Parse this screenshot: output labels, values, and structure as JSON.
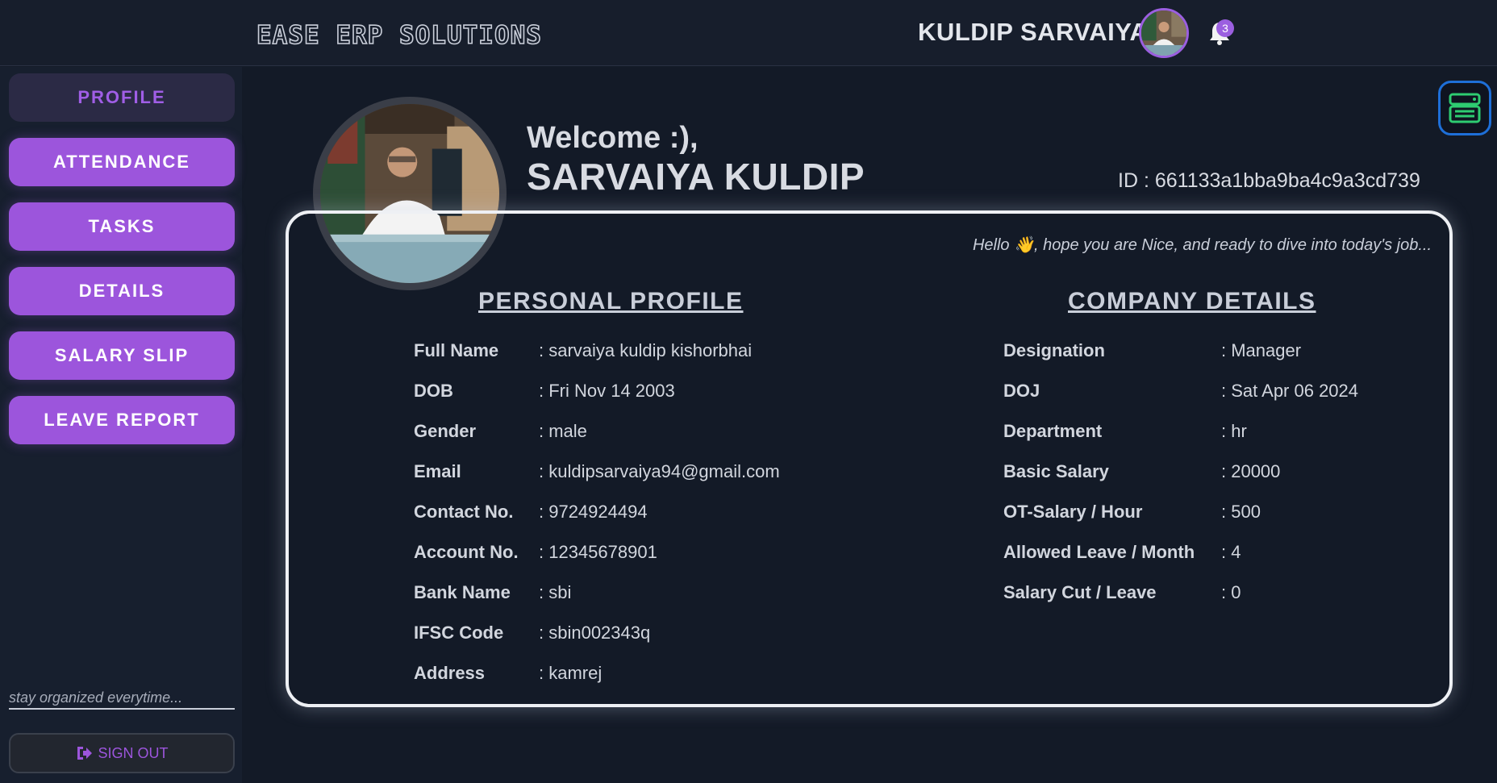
{
  "header": {
    "brand": "EASE ERP SOLUTIONS",
    "user_name": "KULDIP SARVAIYA",
    "notification_count": "3"
  },
  "sidebar": {
    "items": [
      {
        "label": "PROFILE",
        "active": true
      },
      {
        "label": "ATTENDANCE",
        "active": false
      },
      {
        "label": "TASKS",
        "active": false
      },
      {
        "label": "DETAILS",
        "active": false
      },
      {
        "label": "SALARY SLIP",
        "active": false
      },
      {
        "label": "LEAVE REPORT",
        "active": false
      }
    ],
    "tagline": "stay organized everytime...",
    "signout_label": "SIGN OUT"
  },
  "main": {
    "welcome": "Welcome :),",
    "name": "SARVAIYA KULDIP",
    "id_text": "ID : 661133a1bba9ba4c9a3cd739",
    "hello": "Hello 👋, hope you are Nice, and ready to dive into today's job...",
    "personal": {
      "title": "PERSONAL PROFILE",
      "rows": [
        {
          "label": "Full Name",
          "value": ": sarvaiya kuldip kishorbhai"
        },
        {
          "label": "DOB",
          "value": ": Fri Nov 14 2003"
        },
        {
          "label": "Gender",
          "value": ": male"
        },
        {
          "label": "Email",
          "value": ": kuldipsarvaiya94@gmail.com"
        },
        {
          "label": "Contact No.",
          "value": ": 9724924494"
        },
        {
          "label": "Account No.",
          "value": ": 12345678901"
        },
        {
          "label": "Bank Name",
          "value": ": sbi"
        },
        {
          "label": "IFSC Code",
          "value": ": sbin002343q"
        },
        {
          "label": "Address",
          "value": ": kamrej"
        }
      ]
    },
    "company": {
      "title": "COMPANY DETAILS",
      "rows": [
        {
          "label": "Designation",
          "value": ": Manager"
        },
        {
          "label": "DOJ",
          "value": ": Sat Apr 06 2024"
        },
        {
          "label": "Department",
          "value": ": hr"
        },
        {
          "label": "Basic Salary",
          "value": ": 20000"
        },
        {
          "label": "OT-Salary / Hour",
          "value": ": 500"
        },
        {
          "label": "Allowed Leave / Month",
          "value": ": 4"
        },
        {
          "label": "Salary Cut / Leave",
          "value": ": 0"
        }
      ]
    }
  },
  "colors": {
    "accent": "#9c55dc",
    "background": "#131a27",
    "float_button_border": "#1e6fd8",
    "float_button_icon": "#2ecc71"
  },
  "icons": [
    "bell-icon",
    "sign-out-icon",
    "menu-card-icon",
    "profile-photo",
    "user-avatar"
  ]
}
